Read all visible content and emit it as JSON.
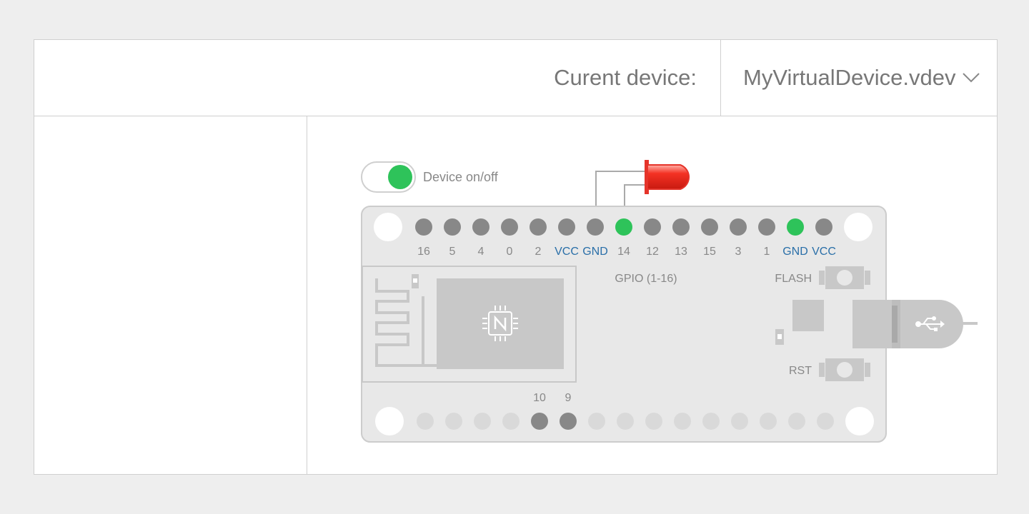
{
  "header": {
    "label": "Curent device:",
    "device_name": "MyVirtualDevice.vdev"
  },
  "toggle": {
    "label": "Device on/off",
    "state": "on"
  },
  "top_pins": [
    {
      "label": "16",
      "type": "gpio",
      "active": false
    },
    {
      "label": "5",
      "type": "gpio",
      "active": false
    },
    {
      "label": "4",
      "type": "gpio",
      "active": false
    },
    {
      "label": "0",
      "type": "gpio",
      "active": false
    },
    {
      "label": "2",
      "type": "gpio",
      "active": false
    },
    {
      "label": "VCC",
      "type": "power",
      "active": false
    },
    {
      "label": "GND",
      "type": "power",
      "active": false
    },
    {
      "label": "14",
      "type": "gpio",
      "active": true
    },
    {
      "label": "12",
      "type": "gpio",
      "active": false
    },
    {
      "label": "13",
      "type": "gpio",
      "active": false
    },
    {
      "label": "15",
      "type": "gpio",
      "active": false
    },
    {
      "label": "3",
      "type": "gpio",
      "active": false
    },
    {
      "label": "1",
      "type": "gpio",
      "active": false
    },
    {
      "label": "GND",
      "type": "power",
      "active": true
    },
    {
      "label": "VCC",
      "type": "power",
      "active": false
    }
  ],
  "bottom_pins": [
    {
      "label": "",
      "enabled": false
    },
    {
      "label": "",
      "enabled": false
    },
    {
      "label": "",
      "enabled": false
    },
    {
      "label": "",
      "enabled": false
    },
    {
      "label": "10",
      "enabled": true
    },
    {
      "label": "9",
      "enabled": true
    },
    {
      "label": "",
      "enabled": false
    },
    {
      "label": "",
      "enabled": false
    },
    {
      "label": "",
      "enabled": false
    },
    {
      "label": "",
      "enabled": false
    },
    {
      "label": "",
      "enabled": false
    },
    {
      "label": "",
      "enabled": false
    },
    {
      "label": "",
      "enabled": false
    },
    {
      "label": "",
      "enabled": false
    },
    {
      "label": "",
      "enabled": false
    }
  ],
  "board": {
    "gpio_label": "GPIO (1-16)",
    "flash_label": "FLASH",
    "rst_label": "RST"
  },
  "led": {
    "color": "red",
    "connected_pins": [
      "GND",
      "14"
    ]
  },
  "colors": {
    "active": "#2ec35a",
    "pin": "#888888",
    "pin_disabled": "#d9d9d9",
    "board": "#e8e8e8",
    "power_label": "#2a6fa8",
    "led": "#ee2a20"
  },
  "icons": [
    "chevron-down-icon",
    "chip-icon",
    "usb-icon"
  ]
}
